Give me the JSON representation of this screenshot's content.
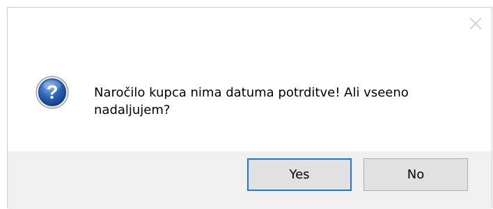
{
  "dialog": {
    "message": "Naročilo kupca nima datuma potrditve! Ali vseeno nadaljujem?",
    "icon": "question-icon",
    "buttons": {
      "yes_label": "Yes",
      "no_label": "No"
    },
    "colors": {
      "icon_blue": "#1f57a8",
      "focus_border": "#1a78d6",
      "footer_bg": "#f0f0f0"
    }
  }
}
